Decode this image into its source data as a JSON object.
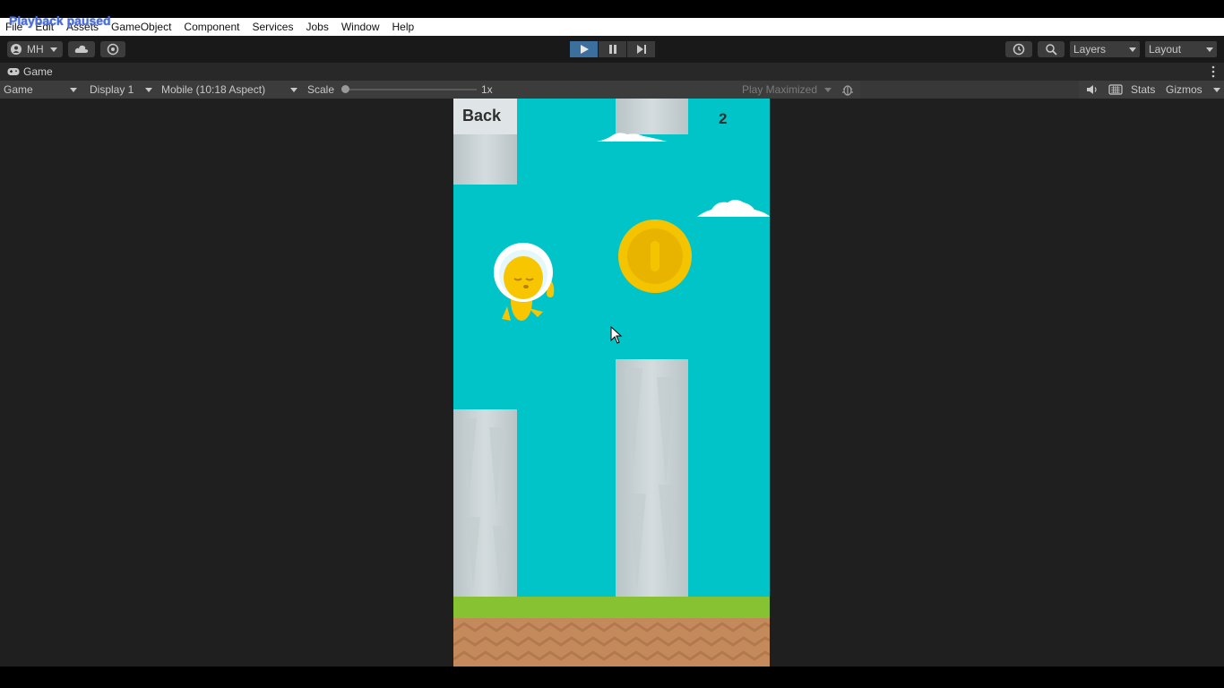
{
  "overlay": {
    "status": "Playback paused"
  },
  "menu": {
    "items": [
      "File",
      "Edit",
      "Assets",
      "GameObject",
      "Component",
      "Services",
      "Jobs",
      "Window",
      "Help"
    ]
  },
  "toolbar": {
    "account_label": "MH",
    "layers_label": "Layers",
    "layout_label": "Layout",
    "play_state": "playing"
  },
  "tab": {
    "label": "Game"
  },
  "game_toolbar": {
    "mode": "Game",
    "display": "Display 1",
    "aspect": "Mobile (10:18 Aspect)",
    "scale_label": "Scale",
    "scale_value": "1x",
    "play_maximized": "Play Maximized",
    "stats": "Stats",
    "gizmos": "Gizmos"
  },
  "game": {
    "back_label": "Back",
    "score": "2",
    "colors": {
      "sky": "#00c4c8",
      "pillar": "#c8d2d4",
      "grass": "#86c232",
      "dirt": "#c58a5c",
      "coin": "#f5c400"
    }
  }
}
